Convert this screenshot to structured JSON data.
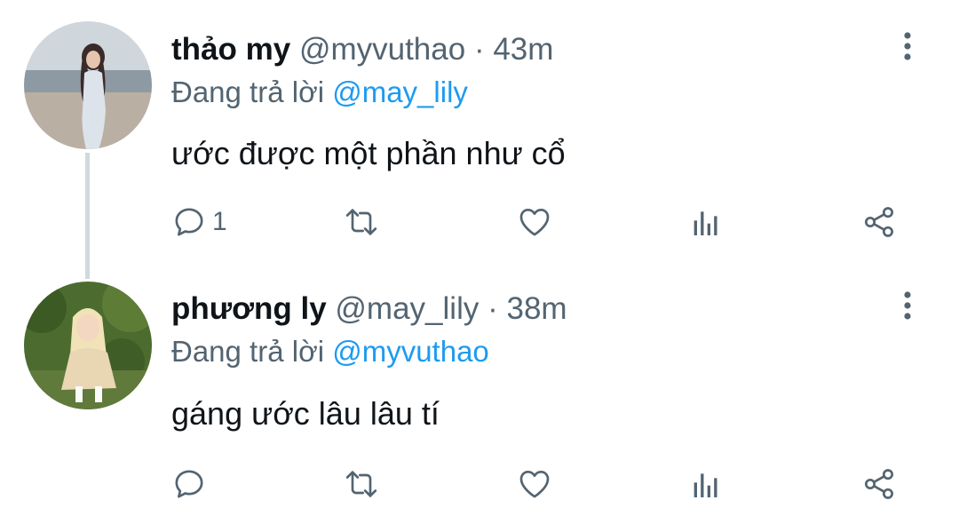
{
  "tweets": [
    {
      "name": "thảo my",
      "handle": "@myvuthao",
      "separator": "·",
      "time": "43m",
      "replying_label": "Đang trả lời",
      "replying_to": "@may_lily",
      "text": "ước được một phần như cổ",
      "reply_count": "1",
      "avatar_icon": "avatar-photo-beach"
    },
    {
      "name": "phương ly",
      "handle": "@may_lily",
      "separator": "·",
      "time": "38m",
      "replying_label": "Đang trả lời",
      "replying_to": "@myvuthao",
      "text": "gáng ước lâu lâu tí",
      "reply_count": "",
      "avatar_icon": "avatar-photo-garden"
    }
  ],
  "colors": {
    "mention": "#1d9bf0",
    "secondary_text": "#536471",
    "primary_text": "#0f1419",
    "thread_line": "#cfd9de"
  }
}
